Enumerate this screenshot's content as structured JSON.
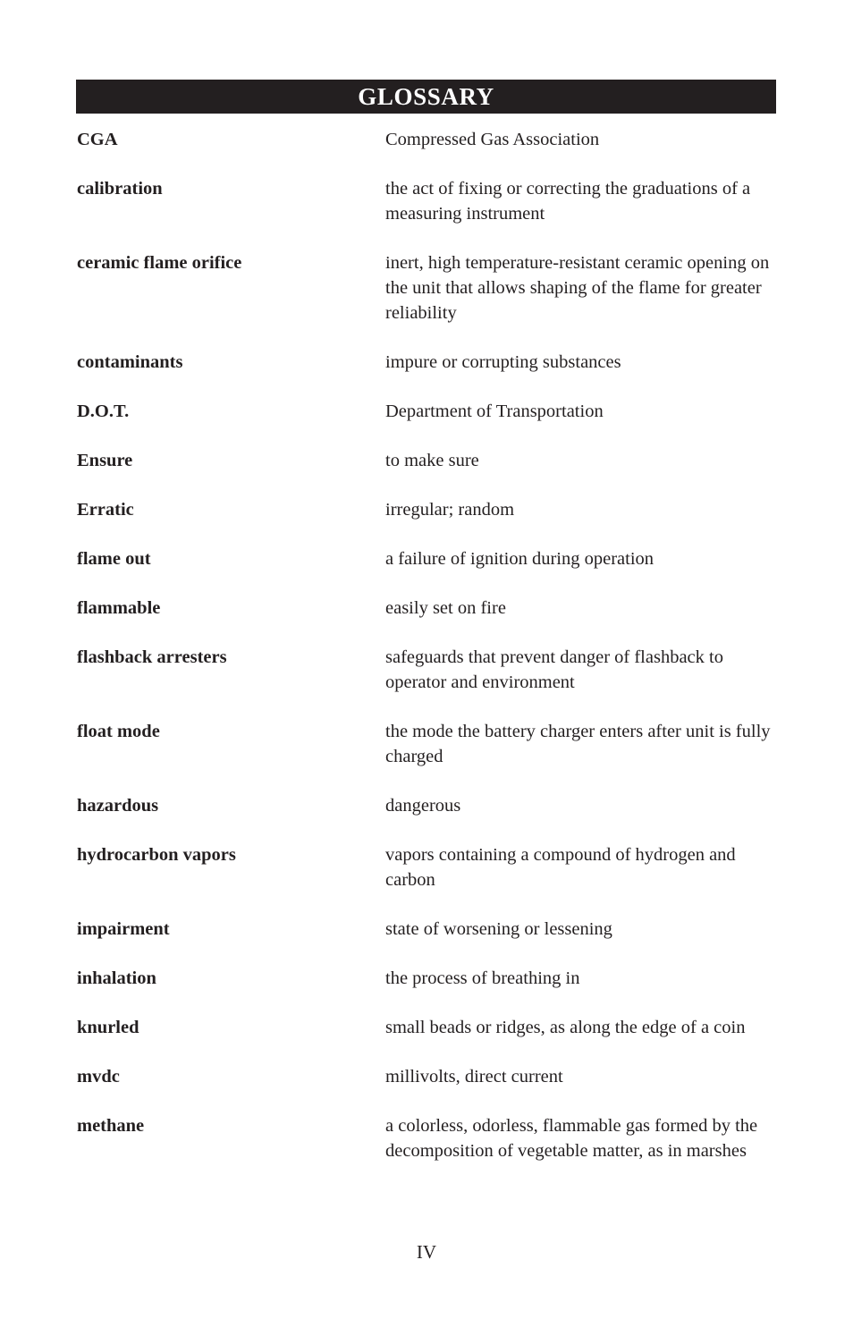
{
  "document": {
    "header": {
      "title": "GLOSSARY",
      "bar_color": "#231f20",
      "text_color": "#ffffff"
    },
    "page_number": "IV",
    "entries": [
      {
        "term": "CGA",
        "definition": "Compressed Gas Association"
      },
      {
        "term": "calibration",
        "definition": "the act of fixing or correcting the graduations of a   measuring instrument"
      },
      {
        "term": "ceramic flame orifice",
        "definition": "inert, high temperature-resistant ceramic opening on the unit that allows shaping of the flame for greater reliability"
      },
      {
        "term": "contaminants",
        "definition": "impure or corrupting substances"
      },
      {
        "term": "D.O.T.",
        "definition": "Department of Transportation"
      },
      {
        "term": "Ensure",
        "definition": "to make sure"
      },
      {
        "term": "Erratic",
        "definition": "irregular; random"
      },
      {
        "term": "flame out",
        "definition": "a failure of ignition during operation"
      },
      {
        "term": "flammable",
        "definition": "easily set on fire"
      },
      {
        "term": "flashback arresters",
        "definition": "safeguards that prevent danger of flashback to operator and environment"
      },
      {
        "term": "float mode",
        "definition": "the mode the battery charger enters after unit is fully charged"
      },
      {
        "term": "hazardous",
        "definition": "dangerous"
      },
      {
        "term": "hydrocarbon vapors",
        "definition": "vapors containing a compound of hydrogen and carbon"
      },
      {
        "term": "impairment",
        "definition": "state of worsening or lessening"
      },
      {
        "term": "inhalation",
        "definition": "the process of breathing in"
      },
      {
        "term": "knurled",
        "definition": "small beads or ridges, as along the edge of a coin"
      },
      {
        "term": "mvdc",
        "definition": "millivolts, direct current"
      },
      {
        "term": "methane",
        "definition": "a colorless, odorless, flammable gas formed by the decomposition of vegetable matter, as in marshes"
      }
    ]
  }
}
